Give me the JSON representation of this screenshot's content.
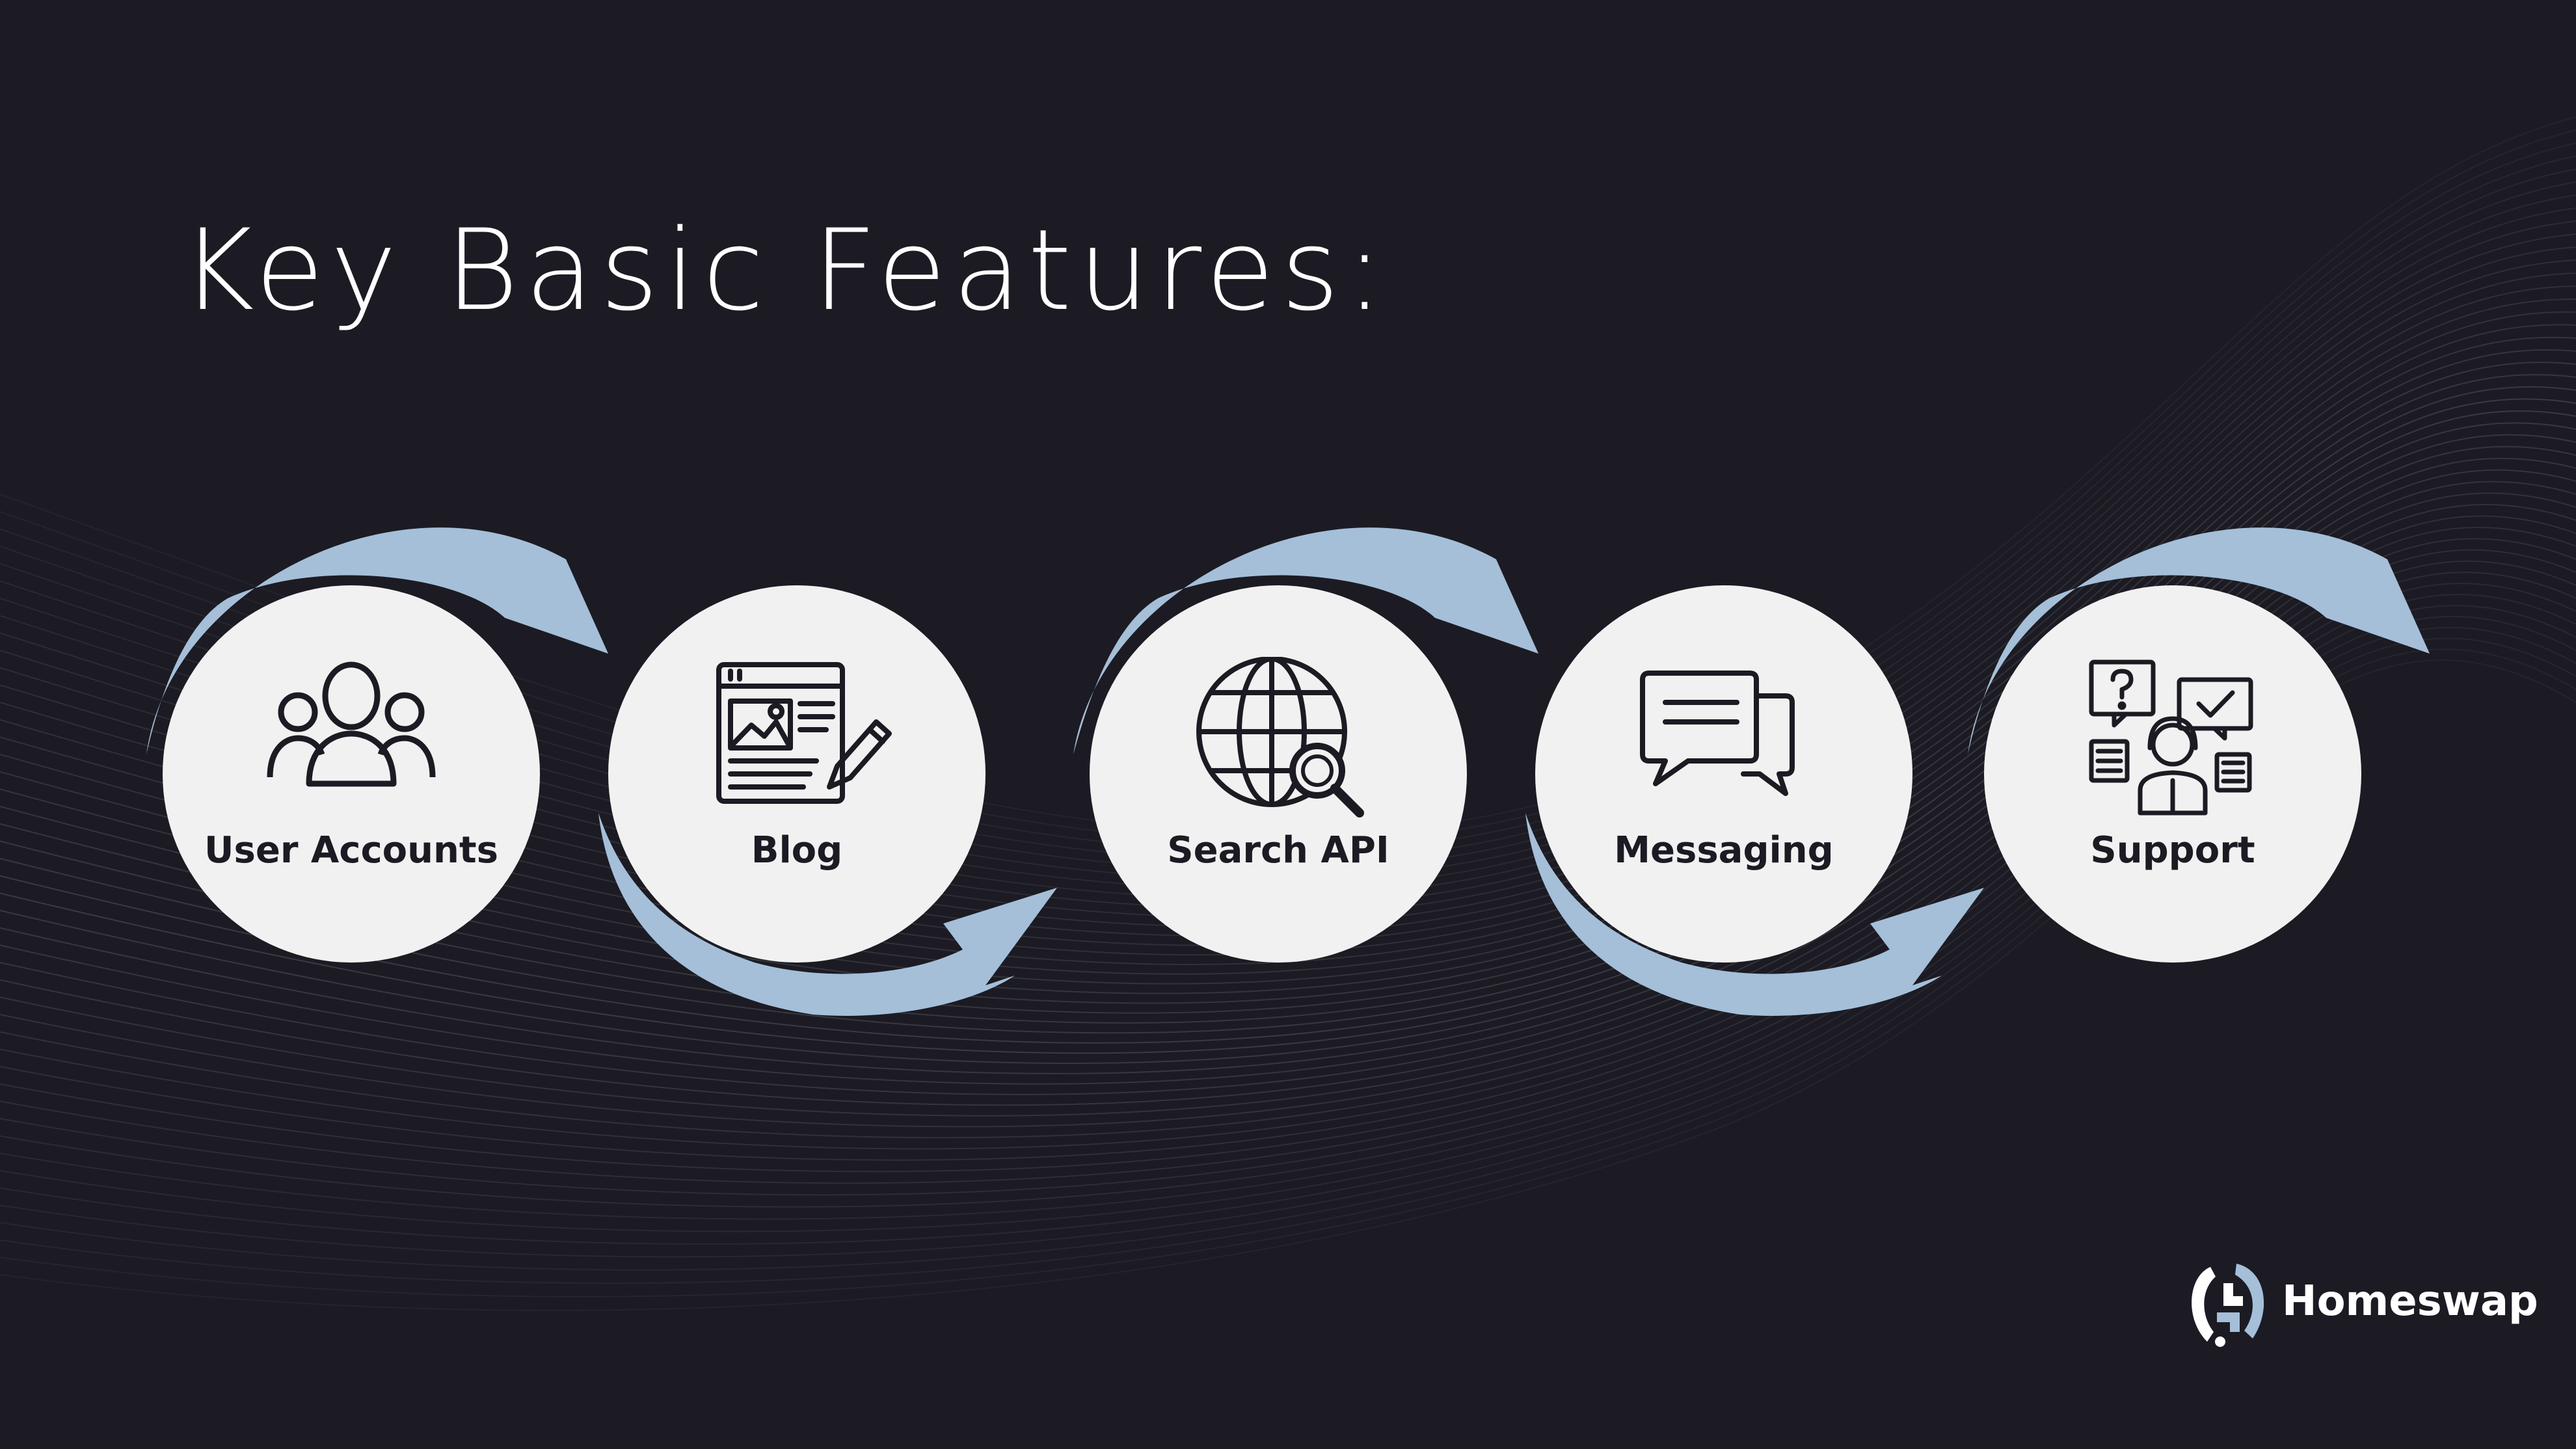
{
  "slide": {
    "title": "Key Basic Features:",
    "accent_color": "#a5bfd9",
    "background_color": "#1c1b23"
  },
  "steps": [
    {
      "label": "User Accounts",
      "icon": "users-icon"
    },
    {
      "label": "Blog",
      "icon": "blog-icon"
    },
    {
      "label": "Search API",
      "icon": "globe-search-icon"
    },
    {
      "label": "Messaging",
      "icon": "chat-bubbles-icon"
    },
    {
      "label": "Support",
      "icon": "support-agent-icon"
    }
  ],
  "brand": {
    "name": "Homeswap",
    "icon": "homeswap-logo-icon"
  }
}
